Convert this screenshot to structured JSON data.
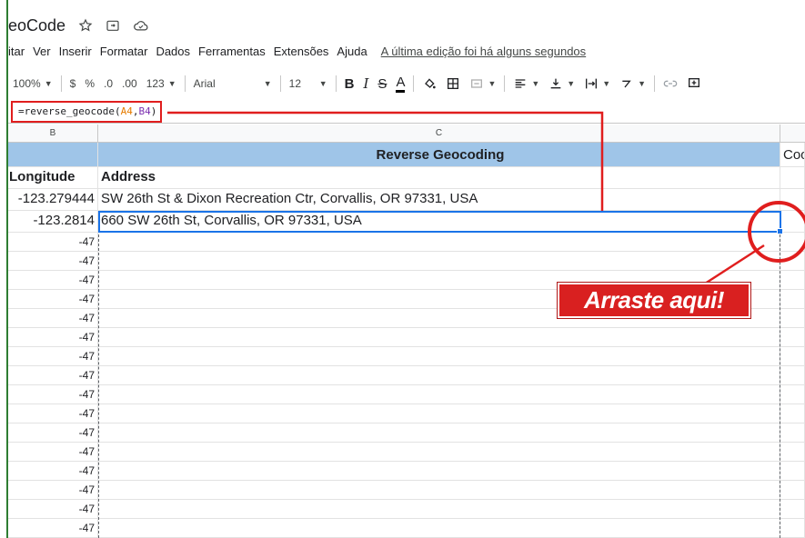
{
  "app": {
    "doc_title": "eoCode",
    "star_icon": "star-outline-icon",
    "move_icon": "move-to-folder-icon",
    "cloud_icon": "cloud-saved-icon"
  },
  "menu": {
    "items": [
      "itar",
      "Ver",
      "Inserir",
      "Formatar",
      "Dados",
      "Ferramentas",
      "Extensões",
      "Ajuda"
    ],
    "last_edit": "A última edição foi há alguns segundos"
  },
  "toolbar": {
    "zoom": "100%",
    "currency": "$",
    "percent": "%",
    "dec_decrease": ".0",
    "dec_increase": ".00",
    "number_format": "123",
    "font": "Arial",
    "font_size": "12",
    "bold": "B",
    "italic": "I",
    "strike": "S",
    "text_color": "A"
  },
  "formula": {
    "prefix": "=reverse_geocode(",
    "arg1": "A4",
    "comma": ",",
    "arg2": "B4",
    "suffix": ")"
  },
  "columns": {
    "b": "B",
    "c": "C"
  },
  "sheet": {
    "band_title": "Reverse Geocoding",
    "band_next": "Coo",
    "header_b": "Longitude",
    "header_c": "Address",
    "rows": [
      {
        "b": "-123.279444",
        "c": "SW 26th St & Dixon Recreation Ctr, Corvallis, OR 97331, USA"
      },
      {
        "b": "-123.2814",
        "c": "660 SW 26th St, Corvallis, OR 97331, USA"
      }
    ],
    "fill_values": [
      "-47",
      "-47",
      "-47",
      "-47",
      "-47",
      "-47",
      "-47",
      "-47",
      "-47",
      "-47",
      "-47",
      "-47",
      "-47",
      "-47",
      "-47",
      "-47"
    ]
  },
  "annotation": {
    "callout": "Arraste aqui!"
  },
  "colors": {
    "band": "#9fc5e8",
    "selection": "#1a73e8",
    "highlight_red": "#e01e1e"
  }
}
